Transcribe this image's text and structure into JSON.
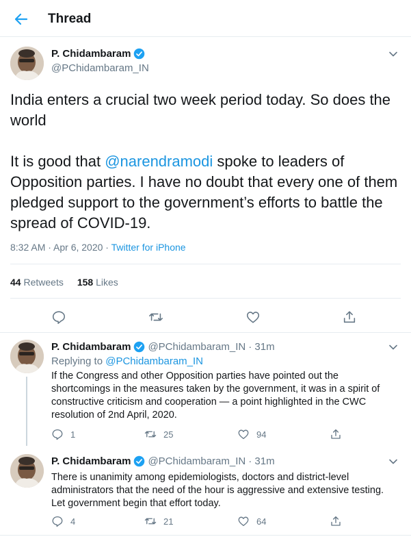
{
  "header": {
    "title": "Thread",
    "back_icon": "arrow-left-icon"
  },
  "accent_color": "#1da1f2",
  "main_tweet": {
    "name": "P. Chidambaram",
    "handle": "@PChidambaram_IN",
    "text_part1": "India enters a crucial two week period today. So does the world\n\nIt is good that ",
    "mention": "@narendramodi",
    "text_part2": " spoke to leaders of Opposition parties. I have no doubt that every one of them pledged support to the government’s efforts to battle the spread of COVID-19.",
    "timestamp": "8:32 AM · Apr 6, 2020 · ",
    "source": "Twitter for iPhone",
    "retweets": "44",
    "retweets_label": "Retweets",
    "likes": "158",
    "likes_label": "Likes"
  },
  "replies": [
    {
      "name": "P. Chidambaram",
      "handle": "@PChidambaram_IN",
      "time": "· 31m",
      "replying_label": "Replying to ",
      "replying_to": "@PChidambaram_IN",
      "text": "If the Congress and other Opposition parties have pointed out the shortcomings in the measures taken by the government, it was in a spirit of constructive criticism and cooperation — a point highlighted in the CWC resolution of 2nd April, 2020.",
      "reply_count": "1",
      "retweet_count": "25",
      "like_count": "94"
    },
    {
      "name": "P. Chidambaram",
      "handle": "@PChidambaram_IN",
      "time": "· 31m",
      "text": "There is unanimity among epidemiologists, doctors and district-level administrators that the need of the hour is aggressive and extensive testing. Let government begin that effort today.",
      "reply_count": "4",
      "retweet_count": "21",
      "like_count": "64"
    }
  ]
}
